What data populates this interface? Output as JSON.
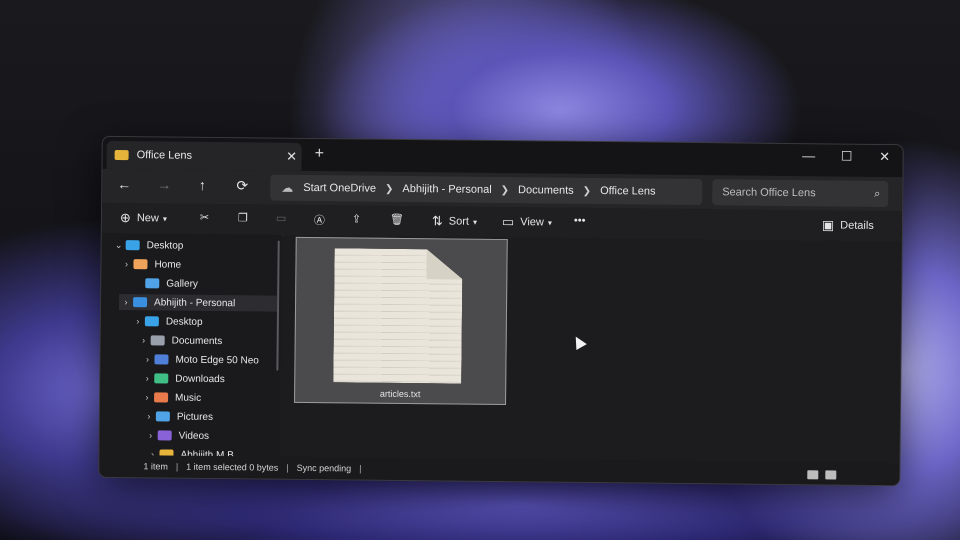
{
  "window": {
    "tab_title": "Office Lens",
    "tab_close": "✕",
    "new_tab": "+",
    "minimize": "—",
    "maximize": "☐",
    "close": "✕"
  },
  "nav": {
    "back": "←",
    "forward": "→",
    "up": "↑",
    "refresh": "⟳"
  },
  "breadcrumb": [
    "Start OneDrive",
    "Abhijith - Personal",
    "Documents",
    "Office Lens"
  ],
  "search": {
    "placeholder": "Search Office Lens"
  },
  "command_bar": {
    "new": "New",
    "sort": "Sort",
    "view": "View",
    "more": "•••",
    "details": "Details"
  },
  "tree": [
    {
      "label": "Desktop",
      "chevron": "⌄",
      "color": "#3aa3e8"
    },
    {
      "label": "Home",
      "chevron": "›",
      "color": "#f0a35a"
    },
    {
      "label": "Gallery",
      "chevron": "",
      "color": "#4fa3e6"
    },
    {
      "label": "Abhijith - Personal",
      "chevron": "›",
      "color": "#3b8fe0",
      "selected": true
    },
    {
      "label": "Desktop",
      "chevron": "›",
      "color": "#3aa3e8"
    },
    {
      "label": "Documents",
      "chevron": "›",
      "color": "#9aa0ab"
    },
    {
      "label": "Moto Edge 50 Neo",
      "chevron": "›",
      "color": "#4f7fd9"
    },
    {
      "label": "Downloads",
      "chevron": "›",
      "color": "#3fbf86"
    },
    {
      "label": "Music",
      "chevron": "›",
      "color": "#e87a4c"
    },
    {
      "label": "Pictures",
      "chevron": "›",
      "color": "#4fa3e6"
    },
    {
      "label": "Videos",
      "chevron": "›",
      "color": "#8a62d8"
    },
    {
      "label": "Abhijith M B",
      "chevron": "›",
      "color": "#e6b43a"
    }
  ],
  "file": {
    "name": "articles.txt"
  },
  "status": {
    "count": "1 item",
    "selected": "1 item selected  0 bytes",
    "sync": "Sync pending"
  }
}
